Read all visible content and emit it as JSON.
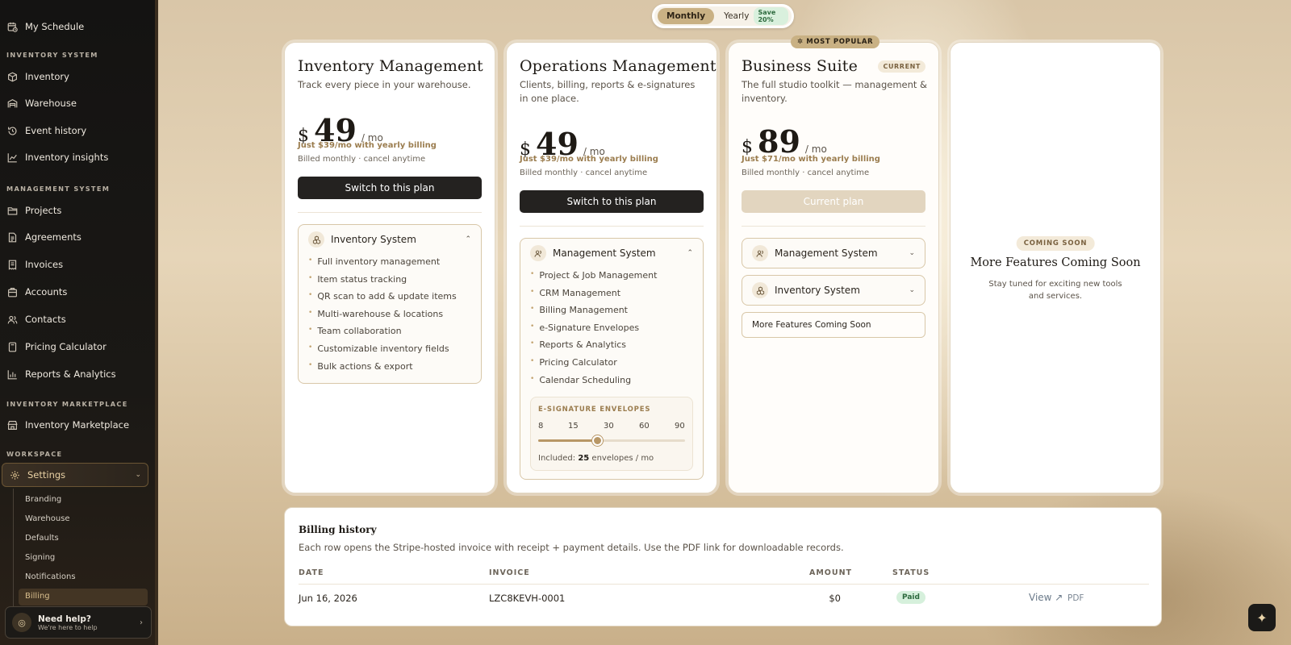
{
  "sidebar": {
    "top_item": "My Schedule",
    "sections": [
      {
        "heading": "INVENTORY SYSTEM",
        "items": [
          "Inventory",
          "Warehouse",
          "Event history",
          "Inventory insights"
        ]
      },
      {
        "heading": "MANAGEMENT SYSTEM",
        "items": [
          "Projects",
          "Agreements",
          "Invoices",
          "Accounts",
          "Contacts",
          "Pricing Calculator",
          "Reports & Analytics"
        ]
      },
      {
        "heading": "INVENTORY MARKETPLACE",
        "items": [
          "Inventory Marketplace"
        ]
      },
      {
        "heading": "WORKSPACE",
        "items": [
          "Settings"
        ]
      }
    ],
    "settings_sub": [
      "Branding",
      "Warehouse",
      "Defaults",
      "Signing",
      "Notifications",
      "Billing"
    ],
    "active_sub": "Billing",
    "help": {
      "title": "Need help?",
      "subtitle": "We're here to help"
    }
  },
  "billing_toggle": {
    "monthly": "Monthly",
    "yearly": "Yearly",
    "save": "Save 20%",
    "selected": "Monthly"
  },
  "plans": [
    {
      "title": "Inventory Management",
      "description": "Track every piece in your warehouse.",
      "currency": "$",
      "price": "49",
      "period": "/ mo",
      "yearly_note": "Just $39/mo with yearly billing",
      "billing_note": "Billed monthly · cancel anytime",
      "button": "Switch to this plan",
      "sections": [
        {
          "name": "Inventory System",
          "expanded": true,
          "features": [
            "Full inventory management",
            "Item status tracking",
            "QR scan to add & update items",
            "Multi-warehouse & locations",
            "Team collaboration",
            "Customizable inventory fields",
            "Bulk actions & export"
          ]
        }
      ]
    },
    {
      "title": "Operations Management",
      "description": "Clients, billing, reports & e-signatures in one place.",
      "currency": "$",
      "price": "49",
      "period": "/ mo",
      "yearly_note": "Just $39/mo with yearly billing",
      "billing_note": "Billed monthly · cancel anytime",
      "button": "Switch to this plan",
      "sections": [
        {
          "name": "Management System",
          "expanded": true,
          "features": [
            "Project & Job Management",
            "CRM Management",
            "Billing Management",
            "e-Signature Envelopes",
            "Reports & Analytics",
            "Pricing Calculator",
            "Calendar Scheduling"
          ]
        }
      ],
      "envelopes": {
        "label": "E-SIGNATURE ENVELOPES",
        "ticks": [
          "8",
          "15",
          "30",
          "60",
          "90"
        ],
        "value_fraction": 0.4,
        "included_prefix": "Included:",
        "included_value": "25",
        "included_suffix": "envelopes / mo"
      }
    },
    {
      "title": "Business Suite",
      "badge": "CURRENT",
      "popular_badge": "MOST POPULAR",
      "description": "The full studio toolkit — management & inventory.",
      "currency": "$",
      "price": "89",
      "period": "/ mo",
      "yearly_note": "Just $71/mo with yearly billing",
      "billing_note": "Billed monthly · cancel anytime",
      "button": "Current plan",
      "sections": [
        {
          "name": "Management System",
          "expanded": false
        },
        {
          "name": "Inventory System",
          "expanded": false
        }
      ],
      "more": "More Features Coming Soon"
    }
  ],
  "coming_soon": {
    "badge": "COMING SOON",
    "title": "More Features Coming Soon",
    "description": "Stay tuned for exciting new tools and services."
  },
  "billing_history": {
    "title": "Billing history",
    "description": "Each row opens the Stripe-hosted invoice with receipt + payment details. Use the PDF link for downloadable records.",
    "columns": {
      "date": "DATE",
      "invoice": "INVOICE",
      "amount": "AMOUNT",
      "status": "STATUS"
    },
    "rows": [
      {
        "date": "Jun 16, 2026",
        "invoice": "LZC8KEVH-0001",
        "amount": "$0",
        "status": "Paid",
        "view": "View ↗",
        "pdf": "PDF"
      }
    ]
  },
  "colors": {
    "accent": "#c9b184",
    "dark_button": "#242220",
    "paid": "#d6f0dc"
  }
}
